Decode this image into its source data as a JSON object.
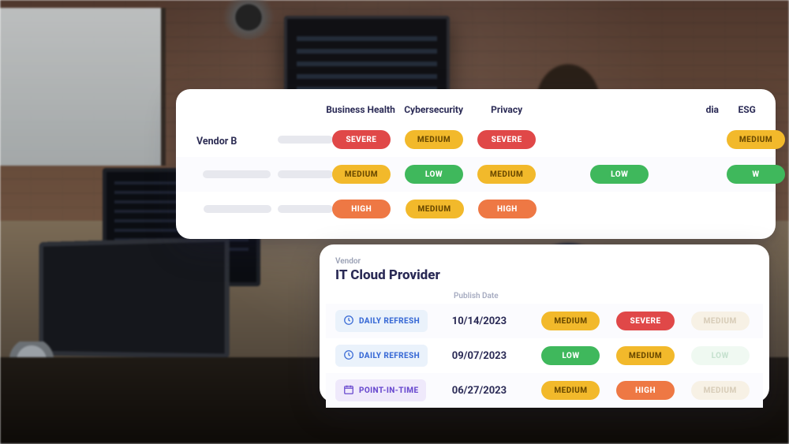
{
  "card1": {
    "columns": [
      "Business Health",
      "Cybersecurity",
      "Privacy",
      "",
      "dia",
      "ESG"
    ],
    "vendor_label": "Vendor B",
    "rows": [
      {
        "cells": [
          "SEVERE",
          "MEDIUM",
          "SEVERE",
          "",
          "",
          "MEDIUM"
        ]
      },
      {
        "cells": [
          "MEDIUM",
          "LOW",
          "MEDIUM",
          "LOW",
          "",
          "W"
        ]
      },
      {
        "cells": [
          "HIGH",
          "MEDIUM",
          "HIGH",
          "",
          "",
          ""
        ]
      }
    ]
  },
  "card2": {
    "subtitle": "Vendor",
    "title": "IT Cloud Provider",
    "publish_label": "Publish Date",
    "rows": [
      {
        "mode": "DAILY REFRESH",
        "mode_type": "refresh",
        "date": "10/14/2023",
        "pills": [
          "MEDIUM",
          "SEVERE",
          "MEDIUM"
        ],
        "faded": [
          false,
          false,
          true
        ]
      },
      {
        "mode": "DAILY REFRESH",
        "mode_type": "refresh",
        "date": "09/07/2023",
        "pills": [
          "LOW",
          "MEDIUM",
          "LOW"
        ],
        "faded": [
          false,
          false,
          true
        ]
      },
      {
        "mode": "POINT-IN-TIME",
        "mode_type": "pit",
        "date": "06/27/2023",
        "pills": [
          "MEDIUM",
          "HIGH",
          "MEDIUM"
        ],
        "faded": [
          false,
          false,
          true
        ]
      }
    ]
  },
  "severity_class": {
    "SEVERE": "sev-severe",
    "HIGH": "sev-high",
    "MEDIUM": "sev-medium",
    "LOW": "sev-low",
    "W": "sev-low"
  }
}
